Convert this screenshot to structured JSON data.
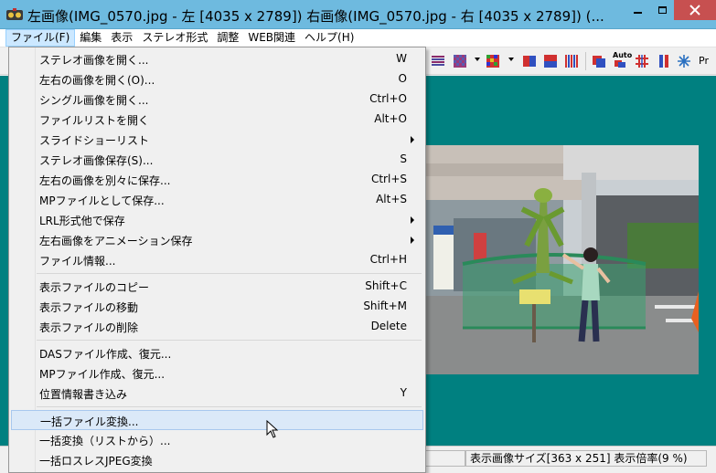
{
  "window": {
    "title": "左画像(IMG_0570.jpg - 左 [4035 x 2789]) 右画像(IMG_0570.jpg - 右 [4035 x 2789])  (...",
    "title_bar_color": "#6ebadf",
    "close_button_color": "#c75050"
  },
  "menubar": {
    "items": [
      "ファイル(F)",
      "編集",
      "表示",
      "ステレオ形式",
      "調整",
      "WEB関連",
      "ヘルプ(H)"
    ]
  },
  "toolbar": {
    "auto_label": "Auto",
    "partial_label": "Pr"
  },
  "main": {
    "background_color": "#008080"
  },
  "status": {
    "left_fragment": ")",
    "display_info": "表示画像サイズ[363 x 251]  表示倍率(9 %)"
  },
  "file_menu": {
    "items": [
      {
        "label": "ステレオ画像を開く...",
        "shortcut": "W"
      },
      {
        "label": "左右の画像を開く(O)...",
        "shortcut": "O"
      },
      {
        "label": "シングル画像を開く...",
        "shortcut": "Ctrl+O"
      },
      {
        "label": "ファイルリストを開く",
        "shortcut": "Alt+O"
      },
      {
        "label": "スライドショーリスト",
        "shortcut": ""
      },
      {
        "label": "ステレオ画像保存(S)...",
        "shortcut": "S"
      },
      {
        "label": "左右の画像を別々に保存...",
        "shortcut": "Ctrl+S"
      },
      {
        "label": "MPファイルとして保存...",
        "shortcut": "Alt+S"
      },
      {
        "label": "LRL形式他で保存",
        "shortcut": ""
      },
      {
        "label": "左右画像をアニメーション保存",
        "shortcut": ""
      },
      {
        "label": "ファイル情報...",
        "shortcut": "Ctrl+H"
      },
      {
        "label": "表示ファイルのコピー",
        "shortcut": "Shift+C"
      },
      {
        "label": "表示ファイルの移動",
        "shortcut": "Shift+M"
      },
      {
        "label": "表示ファイルの削除",
        "shortcut": "Delete"
      },
      {
        "label": "DASファイル作成、復元...",
        "shortcut": ""
      },
      {
        "label": "MPファイル作成、復元...",
        "shortcut": ""
      },
      {
        "label": "位置情報書き込み",
        "shortcut": "Y"
      },
      {
        "label": "一括ファイル変換...",
        "shortcut": ""
      },
      {
        "label": "一括変換（リストから）...",
        "shortcut": ""
      },
      {
        "label": "一括ロスレスJPEG変換",
        "shortcut": ""
      }
    ],
    "highlighted_item": "一括ファイル変換..."
  }
}
